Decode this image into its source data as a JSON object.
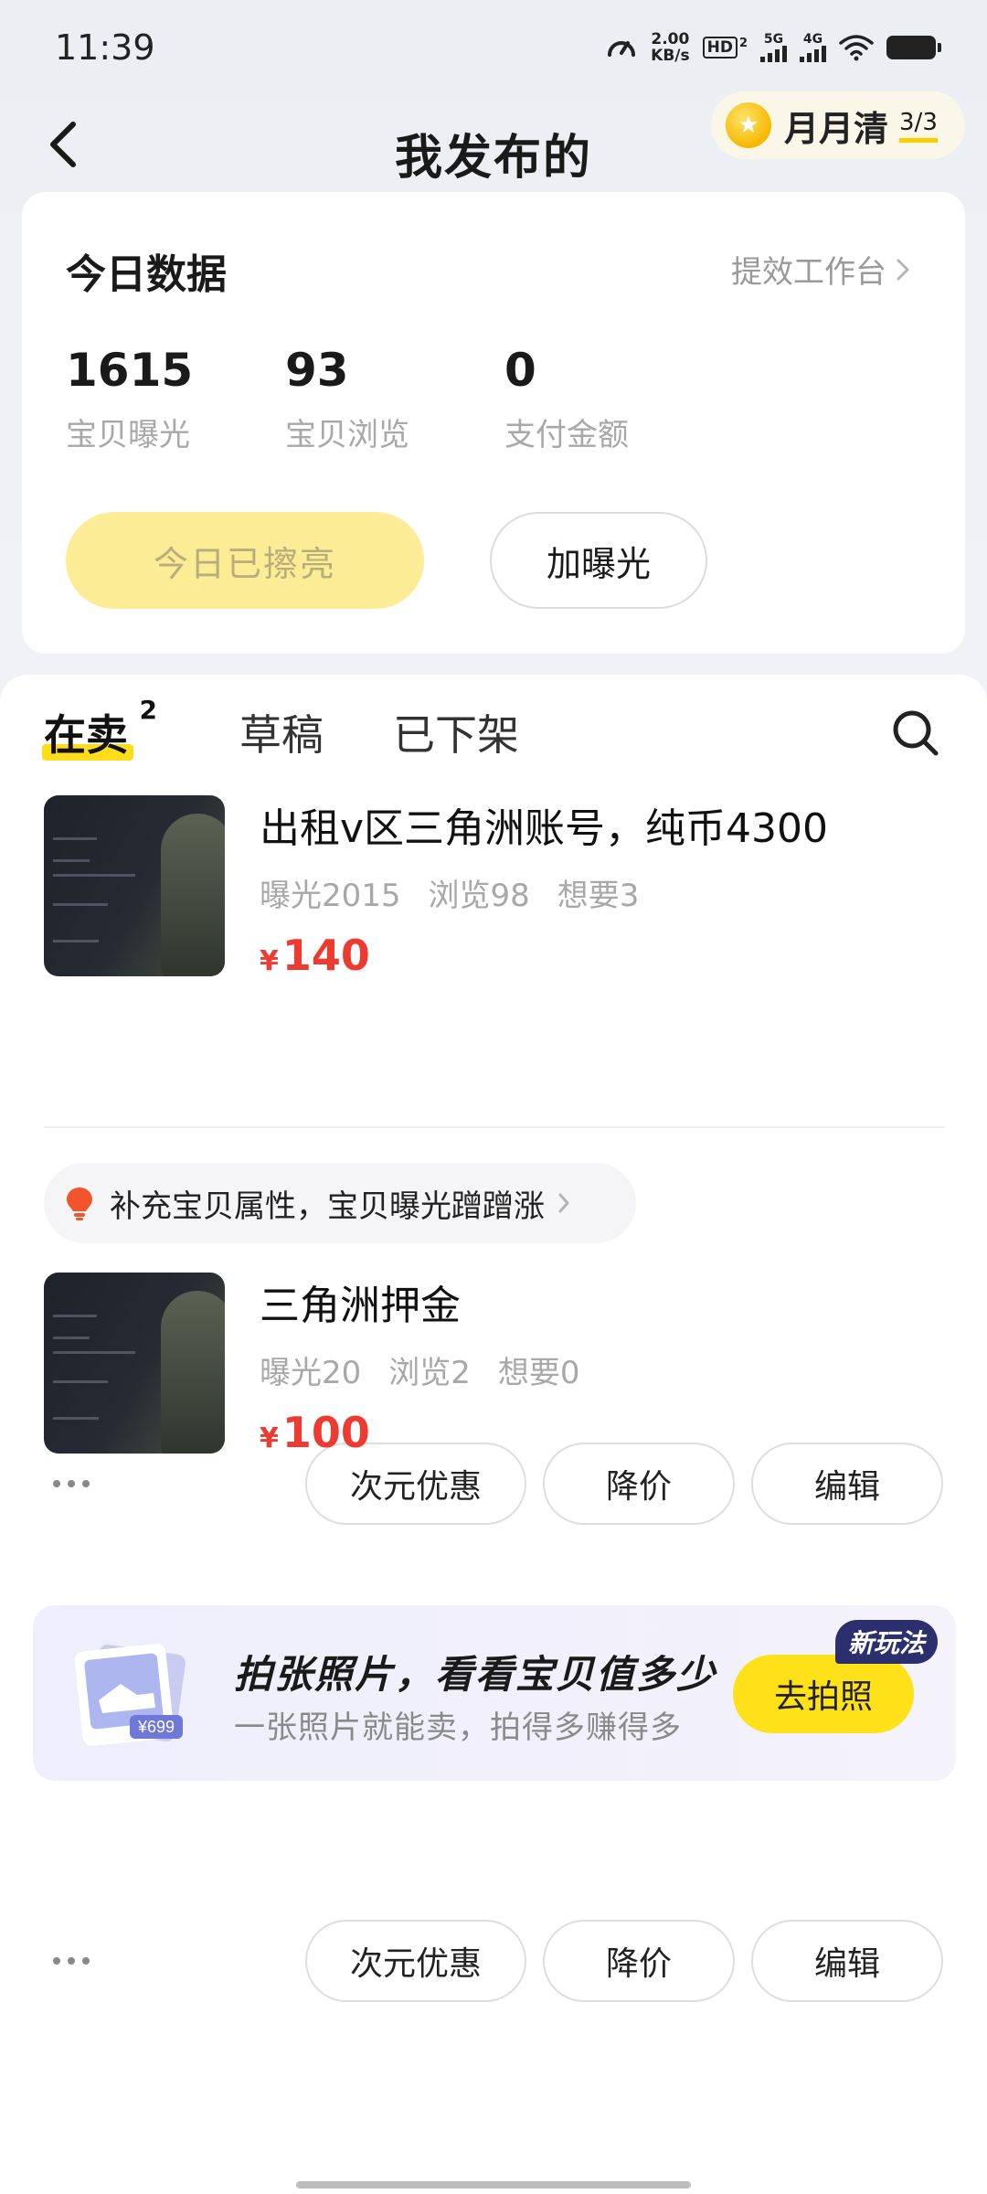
{
  "status_bar": {
    "time": "11:39",
    "net_speed_value": "2.00",
    "net_speed_unit": "KB/s",
    "hd_label": "HD",
    "hd_sub": "2",
    "sig1_label": "5G",
    "sig2_label": "4G",
    "icons": [
      "speedometer-icon",
      "hd-icon",
      "signal-icon",
      "signal-icon",
      "wifi-icon",
      "battery-icon"
    ]
  },
  "nav": {
    "title": "我发布的",
    "back_icon": "chevron-left-icon",
    "monthly": {
      "label": "月月清",
      "count": "3/3",
      "icon": "money-bag-icon"
    }
  },
  "today_data": {
    "title": "今日数据",
    "workbench_link": "提效工作台",
    "stats": [
      {
        "value": "1615",
        "label": "宝贝曝光"
      },
      {
        "value": "93",
        "label": "宝贝浏览"
      },
      {
        "value": "0",
        "label": "支付金额"
      }
    ],
    "polish_button": "今日已擦亮",
    "expose_button": "加曝光"
  },
  "tabs": [
    {
      "label": "在卖",
      "count": "2",
      "active": true
    },
    {
      "label": "草稿",
      "active": false
    },
    {
      "label": "已下架",
      "active": false
    }
  ],
  "items": [
    {
      "title": "出租v区三角洲账号，纯币4300",
      "exposure": "曝光2015",
      "views": "浏览98",
      "wants": "想要3",
      "currency": "¥",
      "price": "140",
      "actions": [
        "次元优惠",
        "降价",
        "编辑"
      ]
    },
    {
      "title": "三角洲押金",
      "exposure": "曝光20",
      "views": "浏览2",
      "wants": "想要0",
      "currency": "¥",
      "price": "100",
      "actions": [
        "次元优惠",
        "降价",
        "编辑"
      ]
    }
  ],
  "tip": {
    "text": "补充宝贝属性，宝贝曝光蹭蹭涨",
    "icon": "bulb-icon"
  },
  "banner": {
    "title": "拍张照片，看看宝贝值多少",
    "subtitle": "一张照片就能卖，拍得多赚得多",
    "price_tag": "¥699",
    "button": "去拍照",
    "badge": "新玩法"
  },
  "colors": {
    "accent_yellow": "#ffdd1a",
    "price_red": "#ee3b32",
    "muted_gray": "#a8a8a8"
  }
}
